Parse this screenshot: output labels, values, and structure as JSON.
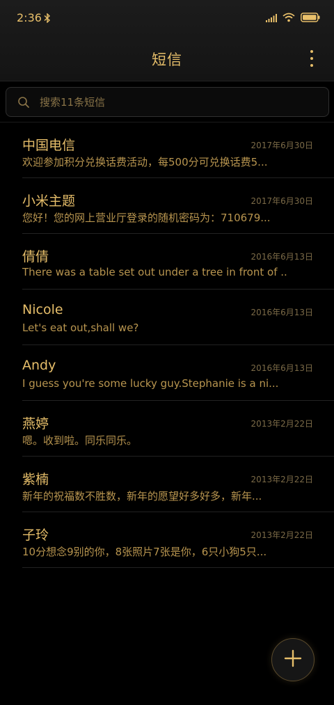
{
  "status_bar": {
    "time": "2:36"
  },
  "header": {
    "title": "短信"
  },
  "search": {
    "placeholder": "搜索11条短信"
  },
  "conversations": [
    {
      "name": "中国电信",
      "date": "2017年6月30日",
      "preview": "欢迎参加积分兑换话费活动，每500分可兑换话费5..."
    },
    {
      "name": "小米主题",
      "date": "2017年6月30日",
      "preview": "您好！您的网上营业厅登录的随机密码为：710679..."
    },
    {
      "name": "倩倩",
      "date": "2016年6月13日",
      "preview": "There was a table set out under a tree in front of ..."
    },
    {
      "name": "Nicole",
      "date": "2016年6月13日",
      "preview": "Let's eat out,shall we?"
    },
    {
      "name": "Andy",
      "date": "2016年6月13日",
      "preview": "I guess you're some lucky guy.Stephanie is a ni..."
    },
    {
      "name": "燕婷",
      "date": "2013年2月22日",
      "preview": "嗯。收到啦。同乐同乐。"
    },
    {
      "name": "紫楠",
      "date": "2013年2月22日",
      "preview": "新年的祝福数不胜数，新年的愿望好多好多，新年..."
    },
    {
      "name": "子玲",
      "date": "2013年2月22日",
      "preview": "10分想念9别的你，8张照片7张是你，6只小狗5只..."
    }
  ],
  "icons": {
    "bluetooth": "bluetooth-icon",
    "signal": "signal-icon",
    "wifi": "wifi-icon",
    "battery": "battery-icon",
    "more": "more-vertical-icon",
    "search": "search-icon",
    "compose": "plus-icon"
  },
  "colors": {
    "accent": "#e6be6a",
    "background": "#000000"
  }
}
